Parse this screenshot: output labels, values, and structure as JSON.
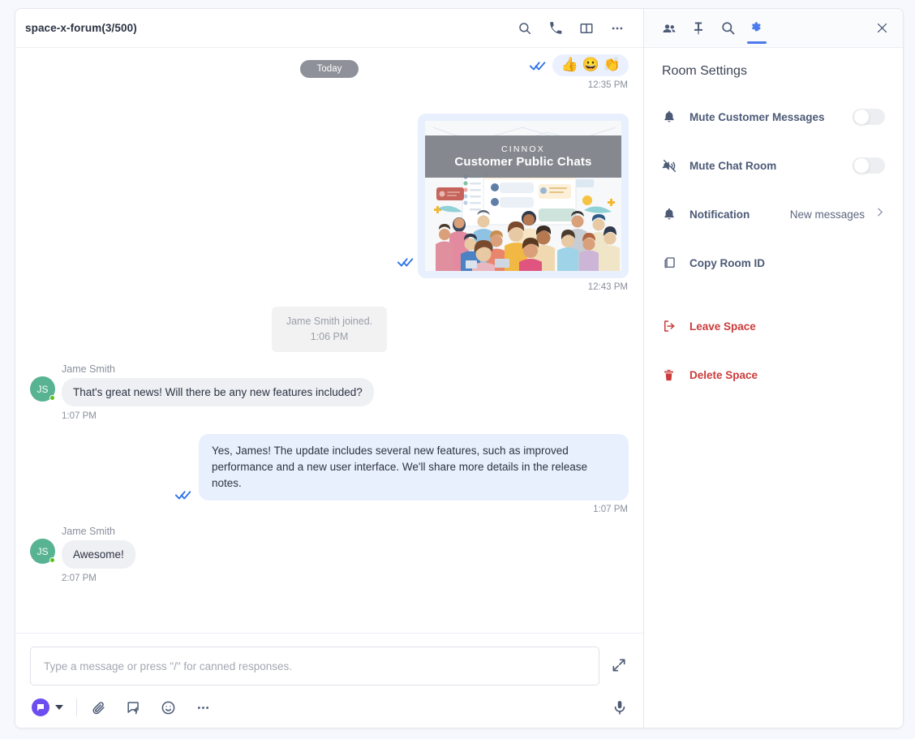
{
  "chat": {
    "header": {
      "room_title": "space-x-forum(3/500)",
      "icons": [
        "search-icon",
        "phone-icon",
        "split-view-icon",
        "more-horizontal-icon"
      ]
    },
    "day_divider": "Today",
    "messages": [
      {
        "id": "reaction-msg",
        "type": "reactions",
        "reactions": [
          "👍",
          "😀",
          "👏"
        ],
        "time": "12:35 PM",
        "status": "read"
      },
      {
        "id": "image-msg",
        "type": "image",
        "banner_line1": "CINNOX",
        "banner_line2": "Customer Public Chats",
        "time": "12:43 PM",
        "status": "read"
      },
      {
        "id": "system-msg",
        "type": "system",
        "text": "Jame Smith joined.",
        "time": "1:06 PM"
      },
      {
        "id": "in-1",
        "type": "incoming",
        "sender": "Jame Smith",
        "avatar_initials": "JS",
        "text": "That's great news! Will there be any new features included?",
        "time": "1:07 PM"
      },
      {
        "id": "out-1",
        "type": "outgoing",
        "text": "Yes, James! The update includes several new features, such as improved performance and a new user interface. We'll share more details in the release notes.",
        "time": "1:07 PM",
        "status": "read"
      },
      {
        "id": "in-2",
        "type": "incoming",
        "sender": "Jame Smith",
        "avatar_initials": "JS",
        "text": "Awesome!",
        "time": "2:07 PM"
      }
    ],
    "composer": {
      "placeholder": "Type a message or press \"/\" for canned responses.",
      "tools": [
        "attachment-icon",
        "canned-response-icon",
        "emoji-icon",
        "more-horizontal-icon"
      ],
      "mic": "microphone-icon",
      "expand": "expand-icon",
      "channel_color": "#6c4ef0"
    }
  },
  "settings": {
    "tabs": [
      {
        "name": "people-icon",
        "active": false
      },
      {
        "name": "pin-icon",
        "active": false
      },
      {
        "name": "search-icon",
        "active": false
      },
      {
        "name": "gear-icon",
        "active": true
      }
    ],
    "close_label": "×",
    "title": "Room Settings",
    "rows": [
      {
        "id": "mute-customer-messages",
        "label": "Mute Customer Messages",
        "icon": "bell-icon",
        "control": "toggle",
        "value": false
      },
      {
        "id": "mute-chat-room",
        "label": "Mute Chat Room",
        "icon": "bell-off-icon",
        "control": "toggle",
        "value": false
      },
      {
        "id": "notification",
        "label": "Notification",
        "icon": "bell-icon",
        "control": "select",
        "value": "New messages"
      },
      {
        "id": "copy-room-id",
        "label": "Copy Room ID",
        "icon": "copy-icon",
        "control": "none"
      },
      {
        "id": "leave-space",
        "label": "Leave Space",
        "icon": "logout-icon",
        "control": "none",
        "danger": true
      },
      {
        "id": "delete-space",
        "label": "Delete Space",
        "icon": "trash-icon",
        "control": "none",
        "danger": true
      }
    ],
    "colors": {
      "accent": "#4b7bec",
      "danger": "#cc3b3b",
      "label": "#4c5a76"
    }
  }
}
